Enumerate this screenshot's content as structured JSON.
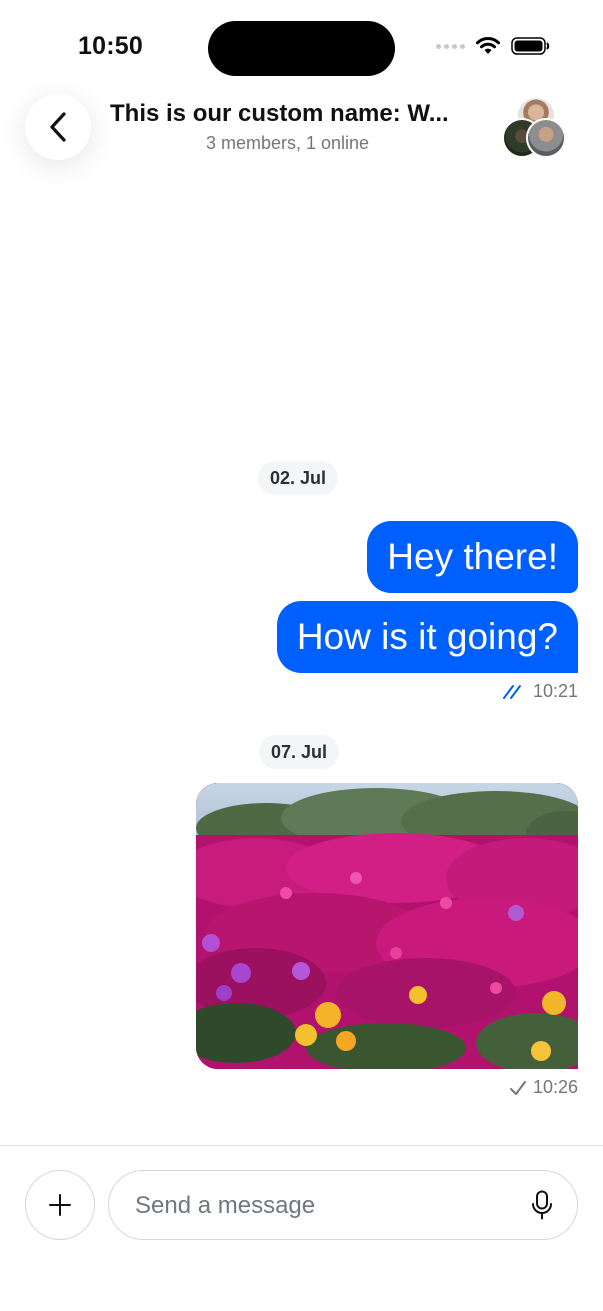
{
  "status_bar": {
    "time": "10:50",
    "icons": [
      "signal-dots-icon",
      "wifi-icon",
      "battery-icon"
    ]
  },
  "header": {
    "back_icon": "chevron-left-icon",
    "title": "This is our custom name: W...",
    "subtitle": "3 members, 1 online"
  },
  "messages": {
    "date_1": "02. Jul",
    "bubble_1": "Hey there!",
    "bubble_2": "How is it going?",
    "time_1": "10:21",
    "status_1_icon": "double-check-icon",
    "date_2": "07. Jul",
    "photo_subject": "pink and yellow flower field photo",
    "time_2": "10:26",
    "status_2_icon": "single-check-icon"
  },
  "composer": {
    "attach_icon": "plus-icon",
    "placeholder": "Send a message",
    "value": "",
    "mic_icon": "microphone-icon"
  },
  "colors": {
    "accent": "#005fff",
    "secondary_text": "#72767e",
    "chip_bg": "#f4f5f7",
    "border": "#d5d8dc"
  }
}
